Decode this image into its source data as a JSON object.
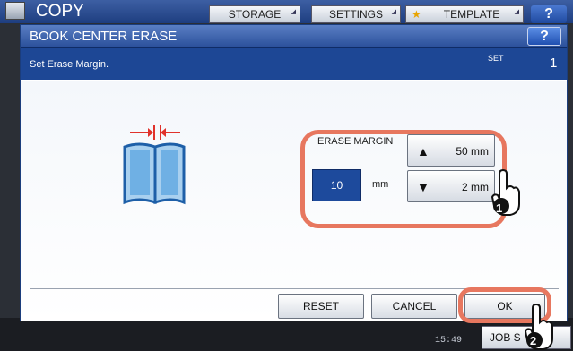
{
  "background": {
    "app_title": "COPY",
    "buttons": [
      "STORAGE",
      "SETTINGS",
      "TEMPLATE"
    ],
    "help": "?",
    "clock": "15:49",
    "job_button": "JOB S"
  },
  "dialog": {
    "title": "BOOK CENTER ERASE",
    "help": "?",
    "instruction": "Set Erase Margin.",
    "set_label": "SET",
    "set_count": "1",
    "erase_margin": {
      "label": "ERASE MARGIN",
      "value": "10",
      "unit": "mm",
      "max_label": "50 mm",
      "min_label": "2 mm"
    },
    "buttons": {
      "reset": "RESET",
      "cancel": "CANCEL",
      "ok": "OK"
    },
    "callouts": [
      "1",
      "2"
    ]
  },
  "colors": {
    "highlight_ring": "#e7775f",
    "title_blue": "#2a4f9a",
    "value_box": "#1d4a9c"
  }
}
